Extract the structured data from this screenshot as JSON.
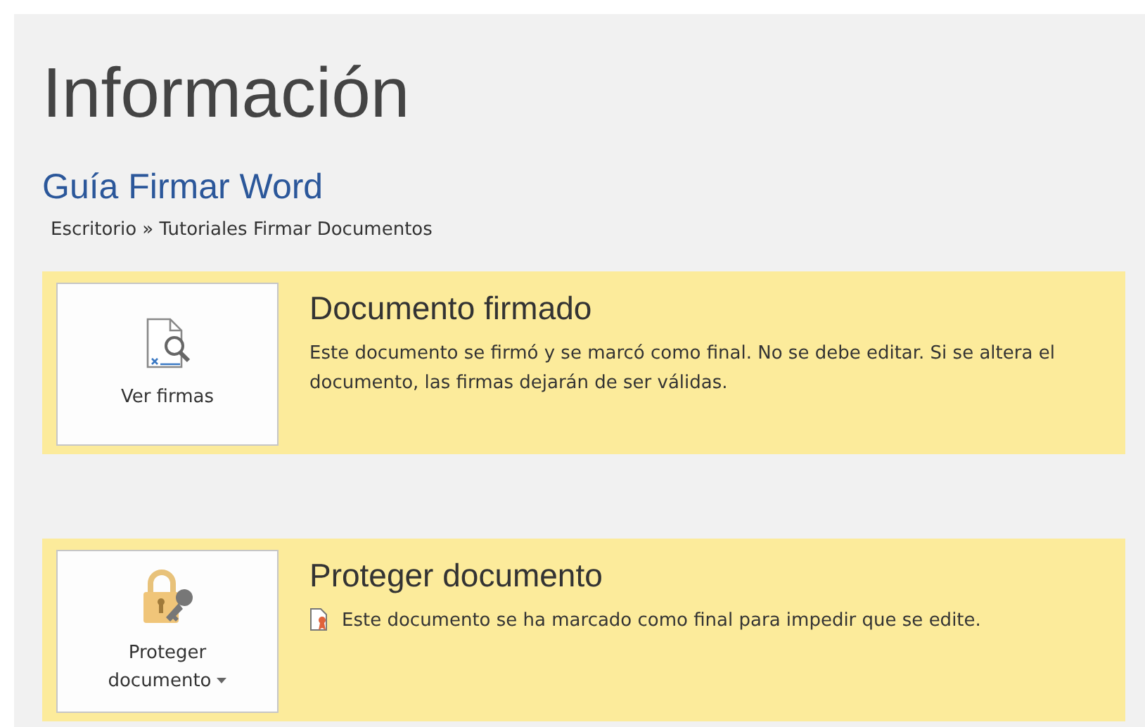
{
  "title": "Información",
  "document": {
    "name": "Guía Firmar Word",
    "path": "Escritorio » Tutoriales Firmar Documentos"
  },
  "sections": [
    {
      "kind": "signatures",
      "button": {
        "label": "Ver firmas",
        "dropdown": false
      },
      "heading": "Documento firmado",
      "text": "Este documento se firmó y se marcó como final. No se debe editar. Si se altera el documento, las firmas dejarán de ser válidas.",
      "note_icon": false
    },
    {
      "kind": "protect",
      "button": {
        "label": "Proteger documento",
        "dropdown": true
      },
      "heading": "Proteger documento",
      "text": "Este documento se ha marcado como final para impedir que se edite.",
      "note_icon": true
    }
  ]
}
